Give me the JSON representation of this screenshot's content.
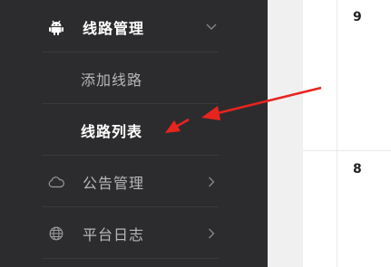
{
  "sidebar": {
    "items": [
      {
        "label": "线路管理",
        "icon": "android-icon",
        "chevron": "chevron-down-icon"
      },
      {
        "label": "添加线路"
      },
      {
        "label": "线路列表"
      },
      {
        "label": "公告管理",
        "icon": "cloud-icon",
        "chevron": "chevron-right-icon"
      },
      {
        "label": "平台日志",
        "icon": "globe-icon",
        "chevron": "chevron-right-icon"
      }
    ]
  },
  "table": {
    "rows": [
      {
        "id": "9"
      },
      {
        "id": "8"
      }
    ]
  },
  "colors": {
    "sidebar_bg": "#2c2c2e",
    "arrow": "#e8241e"
  }
}
